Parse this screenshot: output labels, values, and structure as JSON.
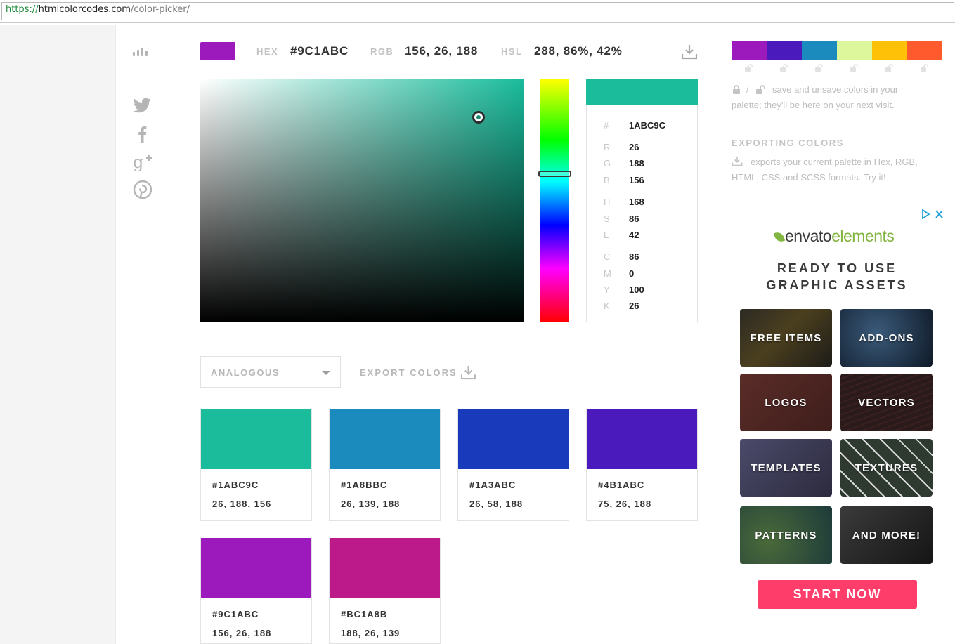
{
  "browser": {
    "url_scheme": "https://",
    "url_host": "htmlcolorcodes.com",
    "url_path": "/color-picker/"
  },
  "header": {
    "hex_label": "HEX",
    "hex_value": "#9C1ABC",
    "rgb_label": "RGB",
    "rgb_value": "156, 26, 188",
    "hsl_label": "HSL",
    "hsl_value": "288, 86%, 42%"
  },
  "colors": {
    "current": "#9C1ABC",
    "selected": "#1ABC9C",
    "palette": [
      "#9C1ABC",
      "#4B1ABC",
      "#1A8BBC",
      "#DDF79C",
      "#FFC107",
      "#FF5A2D"
    ]
  },
  "value_card": {
    "rows": [
      {
        "k": "#",
        "v": "1ABC9C"
      },
      {
        "k": "R",
        "v": "26"
      },
      {
        "k": "G",
        "v": "188"
      },
      {
        "k": "B",
        "v": "156"
      },
      {
        "k": "H",
        "v": "168"
      },
      {
        "k": "S",
        "v": "86"
      },
      {
        "k": "L",
        "v": "42"
      },
      {
        "k": "C",
        "v": "86"
      },
      {
        "k": "M",
        "v": "0"
      },
      {
        "k": "Y",
        "v": "100"
      },
      {
        "k": "K",
        "v": "26"
      }
    ]
  },
  "controls": {
    "scheme_selected": "ANALOGOUS",
    "export_label": "EXPORT COLORS"
  },
  "schemes": [
    {
      "hex": "#1ABC9C",
      "rgb": "26, 188, 156",
      "color": "#1ABC9C"
    },
    {
      "hex": "#1A8BBC",
      "rgb": "26, 139, 188",
      "color": "#1A8BBC"
    },
    {
      "hex": "#1A3ABC",
      "rgb": "26, 58, 188",
      "color": "#1A3ABC"
    },
    {
      "hex": "#4B1ABC",
      "rgb": "75, 26, 188",
      "color": "#4B1ABC"
    },
    {
      "hex": "#9C1ABC",
      "rgb": "156, 26, 188",
      "color": "#9C1ABC"
    },
    {
      "hex": "#BC1A8B",
      "rgb": "188, 26, 139",
      "color": "#BC1A8B"
    }
  ],
  "sidebar_info": {
    "save_text_line1": "save and unsave colors in your",
    "save_text_line2": "palette; they'll be here on your next visit.",
    "export_heading": "EXPORTING COLORS",
    "export_text_line1": "exports your current palette in Hex, RGB,",
    "export_text_line2": "HTML, CSS and SCSS formats. Try it!"
  },
  "ad": {
    "brand_a": "envato",
    "brand_b": "elements",
    "headline_line1": "READY TO USE",
    "headline_line2": "GRAPHIC ASSETS",
    "tiles": [
      "FREE ITEMS",
      "ADD-ONS",
      "LOGOS",
      "VECTORS",
      "TEMPLATES",
      "TEXTURES",
      "PATTERNS",
      "AND MORE!"
    ],
    "cta": "START NOW"
  }
}
